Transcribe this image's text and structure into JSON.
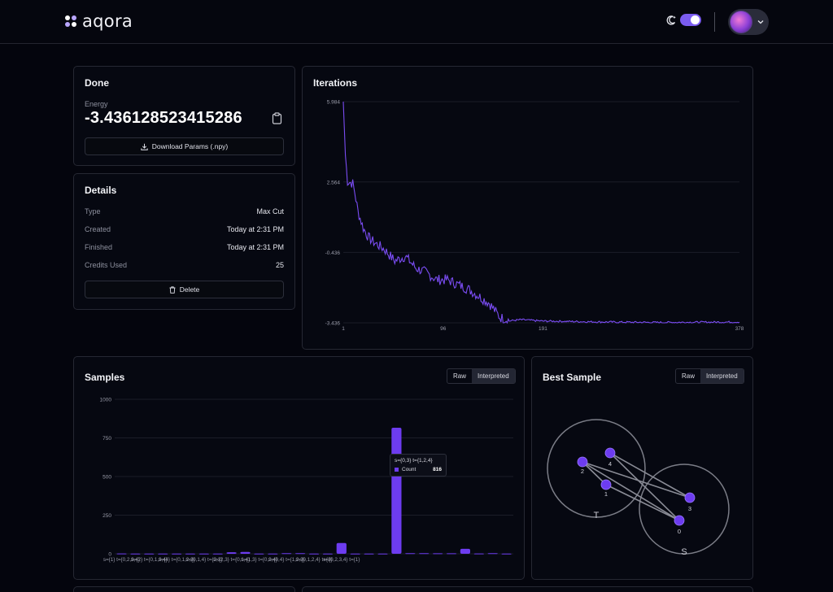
{
  "header": {
    "logo_text": "aqora",
    "icons": {
      "theme": "moon-icon",
      "toggle": "theme-toggle",
      "avatar": "avatar",
      "menu": "chevron-down-icon"
    }
  },
  "done": {
    "title": "Done",
    "energy_label": "Energy",
    "energy_value": "-3.436128523415286",
    "download_label": "Download Params (.npy)"
  },
  "details": {
    "title": "Details",
    "rows": [
      {
        "label": "Type",
        "value": "Max Cut"
      },
      {
        "label": "Created",
        "value": "Today at 2:31 PM"
      },
      {
        "label": "Finished",
        "value": "Today at 2:31 PM"
      },
      {
        "label": "Credits Used",
        "value": "25"
      }
    ],
    "delete_label": "Delete"
  },
  "iterations": {
    "title": "Iterations"
  },
  "samples": {
    "title": "Samples",
    "seg_raw": "Raw",
    "seg_interpreted": "Interpreted",
    "tooltip": {
      "label": "s={0,3} t={1,2,4}",
      "series": "Count",
      "value": "816"
    }
  },
  "best_sample": {
    "title": "Best Sample",
    "seg_raw": "Raw",
    "seg_interpreted": "Interpreted",
    "set_t": "T",
    "set_s": "S",
    "nodes": [
      "0",
      "1",
      "2",
      "3",
      "4"
    ]
  },
  "colors": {
    "accent": "#6d3cf0",
    "line": "#7a4cf2"
  },
  "chart_data": [
    {
      "type": "line",
      "title": "Iterations",
      "x_ticks": [
        1,
        96,
        191,
        378
      ],
      "y_ticks": [
        5.984,
        2.564,
        -0.436,
        -3.436
      ],
      "xlim": [
        1,
        378
      ],
      "ylim": [
        -3.436,
        5.984
      ],
      "grid": true,
      "key_points": [
        [
          1,
          5.984
        ],
        [
          3,
          3.7
        ],
        [
          5,
          2.6
        ],
        [
          10,
          2.5
        ],
        [
          12,
          2.1
        ],
        [
          15,
          1.3
        ],
        [
          20,
          0.6
        ],
        [
          25,
          0.2
        ],
        [
          30,
          0.0
        ],
        [
          40,
          -0.3
        ],
        [
          50,
          -0.8
        ],
        [
          60,
          -0.6
        ],
        [
          70,
          -1.1
        ],
        [
          80,
          -1.3
        ],
        [
          90,
          -1.6
        ],
        [
          100,
          -1.6
        ],
        [
          110,
          -1.8
        ],
        [
          120,
          -2.0
        ],
        [
          130,
          -2.3
        ],
        [
          140,
          -2.6
        ],
        [
          150,
          -3.2
        ],
        [
          160,
          -3.35
        ],
        [
          170,
          -3.3
        ],
        [
          190,
          -3.36
        ],
        [
          250,
          -3.4
        ],
        [
          300,
          -3.42
        ],
        [
          378,
          -3.4
        ]
      ]
    },
    {
      "type": "bar",
      "title": "Samples",
      "ylim": [
        0,
        1000
      ],
      "y_ticks": [
        0,
        250,
        500,
        750,
        1000
      ],
      "categories": [
        "s={1} t={0,2,3,4}",
        "s={2} t={0,1,3,4}",
        "s={4} t={0,1,2,3}",
        "s={0,1,4} t={2,3}",
        "s={2,3} t={0,1,4}",
        "s={1,3} t={0,2,4}",
        "s={0,4} t={1,2,3}",
        "s={0,1,2,4} t={3}",
        "s={0,2,3,4} t={1}"
      ],
      "values": [
        2,
        1,
        1,
        1,
        1,
        1,
        1,
        1,
        10,
        12,
        1,
        1,
        4,
        4,
        1,
        1,
        70,
        1,
        1,
        1,
        816,
        4,
        4,
        3,
        3,
        32,
        2,
        4,
        1
      ],
      "x_tick_positions": [
        0,
        2,
        4,
        6,
        8,
        10,
        12,
        14,
        16
      ]
    }
  ]
}
